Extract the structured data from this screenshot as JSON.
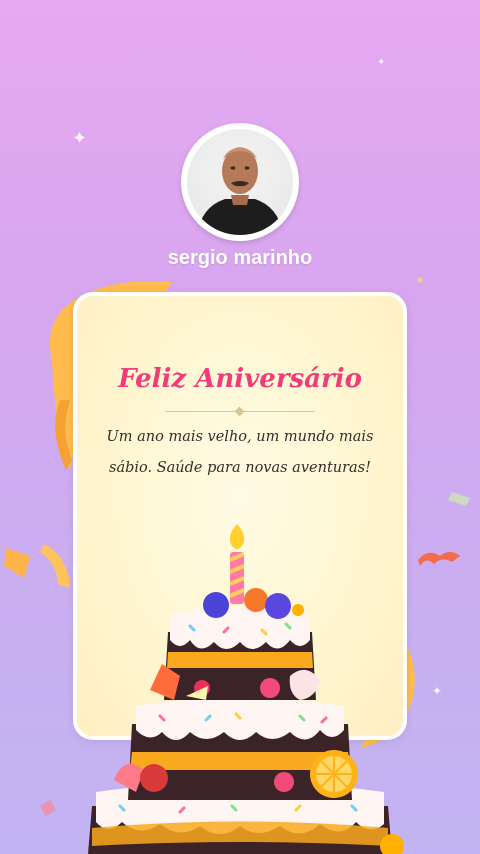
{
  "profile": {
    "name": "sergio marinho",
    "avatar_alt": "profile photo"
  },
  "card": {
    "title": "Feliz Aniversário",
    "message_line1": "Um ano mais velho, um mundo mais",
    "message_line2": "sábio. Saúde para novas aventuras!"
  },
  "colors": {
    "background_top": "#e6a9f2",
    "background_bottom": "#c2b4f2",
    "title": "#f23c7a",
    "ribbon": "#ffb84a",
    "card": "#fff6cf"
  },
  "decor": {
    "cake_icon": "birthday-cake-icon",
    "candle_icon": "candle-icon",
    "sparkle_icon": "sparkle-icon"
  }
}
